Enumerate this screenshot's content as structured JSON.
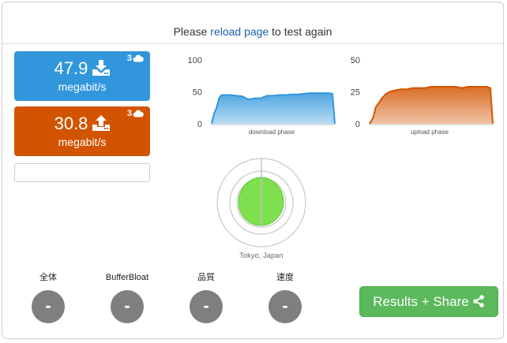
{
  "header": {
    "prefix": "Please ",
    "link": "reload page",
    "suffix": " to test again"
  },
  "download": {
    "value": "47.9",
    "unit": "megabit/s",
    "connections": "3",
    "color": "#3296dc"
  },
  "upload": {
    "value": "30.8",
    "unit": "megabit/s",
    "connections": "3",
    "color": "#d35400"
  },
  "icons": {
    "download": "download-tray-icon",
    "upload": "upload-tray-icon",
    "connections": "cloud-icon",
    "share": "share-nodes-icon"
  },
  "chart_data": [
    {
      "type": "area",
      "xlabel": "download phase",
      "ylim": [
        0,
        100
      ],
      "yticks": [
        "0",
        "50",
        "100"
      ],
      "color": "#3296dc",
      "x": [
        0,
        0.02,
        0.04,
        0.06,
        0.08,
        0.1,
        0.15,
        0.2,
        0.25,
        0.3,
        0.35,
        0.4,
        0.45,
        0.5,
        0.55,
        0.6,
        0.65,
        0.7,
        0.75,
        0.8,
        0.85,
        0.9,
        0.95,
        0.98,
        1.0
      ],
      "values": [
        0,
        16,
        25,
        40,
        45,
        45,
        45,
        44,
        43,
        38,
        40,
        40,
        44,
        44,
        45,
        45,
        46,
        46,
        47,
        48,
        48,
        48,
        48,
        47,
        0
      ]
    },
    {
      "type": "area",
      "xlabel": "upload phase",
      "ylim": [
        0,
        50
      ],
      "yticks": [
        "0",
        "25",
        "50"
      ],
      "color": "#d35400",
      "x": [
        0,
        0.03,
        0.05,
        0.08,
        0.1,
        0.13,
        0.16,
        0.2,
        0.25,
        0.3,
        0.35,
        0.4,
        0.45,
        0.5,
        0.55,
        0.6,
        0.65,
        0.7,
        0.75,
        0.8,
        0.85,
        0.9,
        0.95,
        0.98,
        1.0
      ],
      "values": [
        0,
        5,
        13,
        17,
        20,
        23,
        25,
        26,
        27,
        27,
        28,
        28,
        28,
        29,
        29,
        29,
        29,
        29,
        28,
        29,
        29,
        29,
        29,
        28,
        0
      ]
    }
  ],
  "location": "Tokyo, Japan",
  "metrics": [
    {
      "label": "全体",
      "value": "-"
    },
    {
      "label": "BufferBloat",
      "value": "-"
    },
    {
      "label": "品質",
      "value": "-"
    },
    {
      "label": "速度",
      "value": "-"
    }
  ],
  "share_button": "Results + Share",
  "accent": {
    "share": "#5cb85c",
    "metric": "#7f7f7f",
    "radar_fill": "#7ee04e"
  }
}
